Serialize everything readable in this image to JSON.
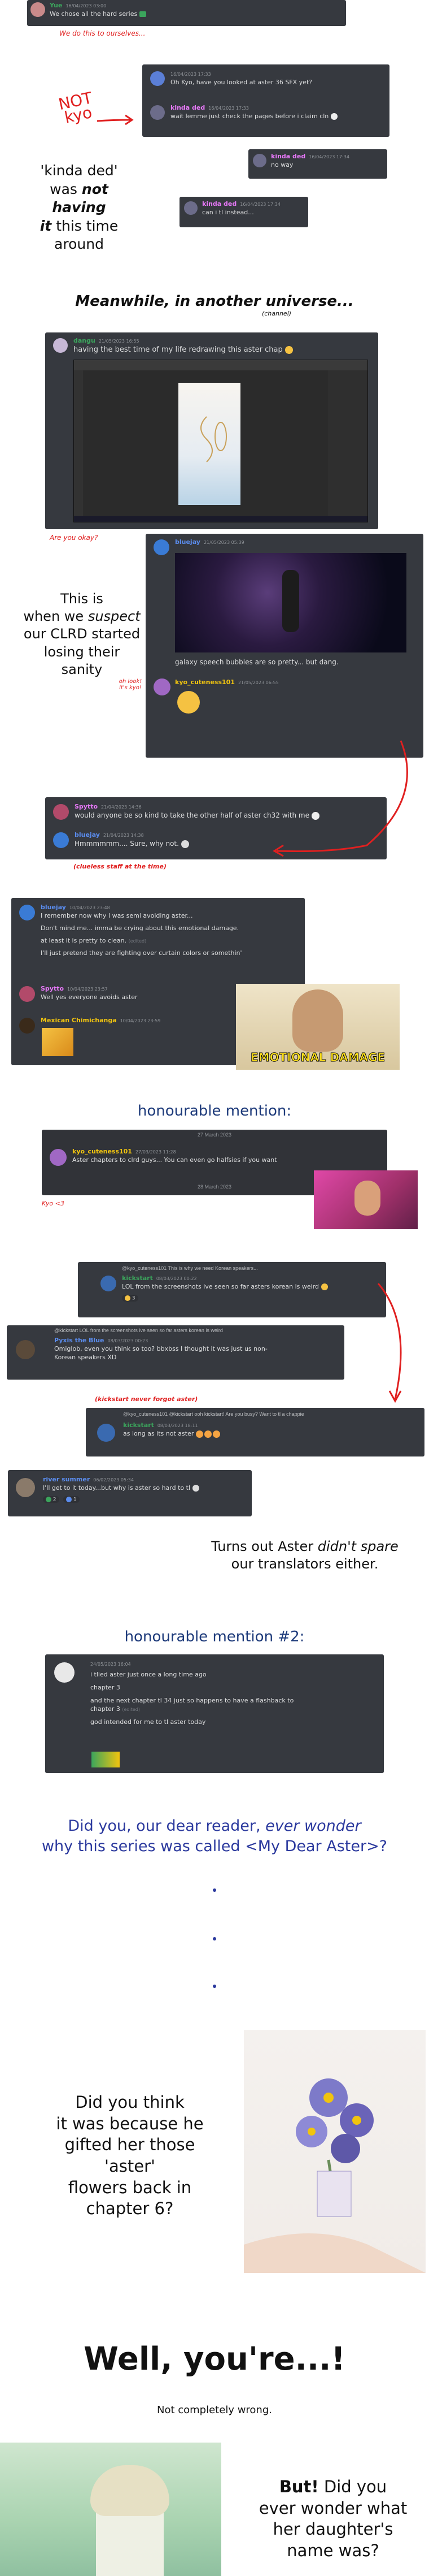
{
  "chat1": {
    "user": "Yue",
    "time": "16/04/2023 03:00",
    "text": "We chose all the hard series",
    "caption": "We do this to ourselves..."
  },
  "chat2": {
    "reply_user": "",
    "user1_time": "16/04/2023 17:33",
    "user1_text": "Oh Kyo, have you looked at aster 36 SFX yet?",
    "user2": "kinda ded",
    "user2_time": "16/04/2023 17:33",
    "user2_text": "wait lemme just check the pages before i claim cln",
    "not_kyo": "NOT kyo"
  },
  "chat3": {
    "user": "kinda ded",
    "time": "16/04/2023 17:34",
    "text": "no way"
  },
  "chat4": {
    "user": "kinda ded",
    "time": "16/04/2023 17:34",
    "text": "can i tl instead..."
  },
  "narration1": {
    "line1": "'kinda ded'",
    "line2_a": "was ",
    "line2_b": "not having",
    "line3_a": "it",
    "line3_b": " this time",
    "line4": "around"
  },
  "universe": {
    "title": "Meanwhile, in another universe...",
    "sub": "(channel)"
  },
  "chat5": {
    "user": "dangu",
    "time": "21/05/2023 16:55",
    "text": "having the best time of my life redrawing this aster chap"
  },
  "okay_caption": "Are you okay?",
  "narration2": {
    "line1": "This is",
    "line2_a": "when we ",
    "line2_b": "suspect",
    "line3": "our CLRD started",
    "line4": "losing their",
    "line5": "sanity"
  },
  "chat6": {
    "user": "bluejay",
    "time": "21/05/2023 05:39",
    "text": "galaxy speech bubbles are so pretty... but dang.",
    "user2": "kyo_cuteness101",
    "user2_time": "21/05/2023 06:55",
    "oh_look": "oh look! it's kyo!"
  },
  "chat7": {
    "user1": "Spytto",
    "user1_time": "21/04/2023 14:36",
    "user1_text": "would anyone be so kind to take the other half of aster ch32 with me",
    "user2": "bluejay",
    "user2_time": "21/04/2023 14:38",
    "user2_text": "Hmmmmmm.... Sure, why not.",
    "clueless": "(clueless staff at the time)"
  },
  "chat8": {
    "user1": "bluejay",
    "user1_time": "10/04/2023 23:48",
    "line1": "I remember now why I was semi avoiding aster...",
    "line2": "Don't mind me... imma be crying about this emotional damage.",
    "line3": "at least it is pretty to clean.",
    "line3_edit": "(edited)",
    "line4": "I'll just pretend they are fighting over curtain colors or somethin'",
    "user2": "Spytto",
    "user2_time": "10/04/2023 23:57",
    "user2_text": "Well yes everyone avoids aster",
    "user3": "Mexican Chimichanga",
    "user3_time": "10/04/2023 23:59",
    "meme_caption": "EMOTIONAL DAMAGE"
  },
  "honourable1": {
    "title": "honourable mention:",
    "date1": "27 March 2023",
    "user": "kyo_cuteness101",
    "time": "27/03/2023 11:28",
    "text": "Aster chapters to clrd guys... You can even go halfsies if you want",
    "date2": "28 March 2023",
    "kyo_love": "Kyo <3"
  },
  "chat9": {
    "reply": "@kyo_cuteness101 This is why we need Korean speakers...",
    "user": "kickstart",
    "time": "08/03/2023 00:22",
    "text": "LOL from the screenshots ive seen so far asters korean is weird",
    "reaction_count": "3"
  },
  "chat10": {
    "reply": "@kickstart LOL from the screenshots ive seen so far asters korean is weird",
    "user": "Pyxis the Blue",
    "time": "08/03/2023 00:23",
    "text1": "Omiglob, even you think so too? bbxbss I thought it was just us non-",
    "text2": "Korean speakers XD",
    "never_forget": "(kickstart never forgot aster)"
  },
  "chat11": {
    "reply": "@kyo_cuteness101 @kickstart ooh kickstart! Are you busy? Want to tl a chappie",
    "user": "kickstart",
    "time": "08/03/2023 18:11",
    "text": "as long as its not aster"
  },
  "chat12": {
    "user": "river summer",
    "time": "06/02/2023 05:34",
    "text": "I'll get to it today...but why is aster so hard to tl",
    "reaction1": "2",
    "reaction2": "1"
  },
  "narration3": {
    "line1_a": "Turns out Aster ",
    "line1_b": "didn't spare",
    "line2": "our translators either."
  },
  "honourable2": {
    "title": "honourable mention #2:",
    "time": "24/05/2023 16:04",
    "line1": "i tlied aster just once a long time ago",
    "line2": "chapter 3",
    "line3": "and the next chapter tl 34 just so happens to have a flashback to",
    "line4": "chapter 3",
    "line4_edit": "(edited)",
    "line5": "god intended for me to tl aster today"
  },
  "question": {
    "line1_a": "Did you, our dear reader, ",
    "line1_b": "ever wonder",
    "line2": "why this series was called <My Dear Aster>?"
  },
  "narration4": {
    "line1": "Did you think",
    "line2": "it was because he",
    "line3": "gifted her those 'aster'",
    "line4": "flowers back in",
    "line5": "chapter 6?"
  },
  "well": {
    "big": "Well, you're...!",
    "small": "Not completely wrong."
  },
  "narration5": {
    "line1_a": "But!",
    "line1_b": " Did you",
    "line2": "ever wonder what",
    "line3": "her daughter's",
    "line4": "name was?"
  },
  "colors": {
    "chat_bg": "#36393f",
    "red": "#e02020",
    "blue_text": "#2c3a9e",
    "username_blue": "#5b8def",
    "username_green": "#3ba55c",
    "username_yellow": "#f1c40f",
    "username_pink": "#e879f9"
  }
}
